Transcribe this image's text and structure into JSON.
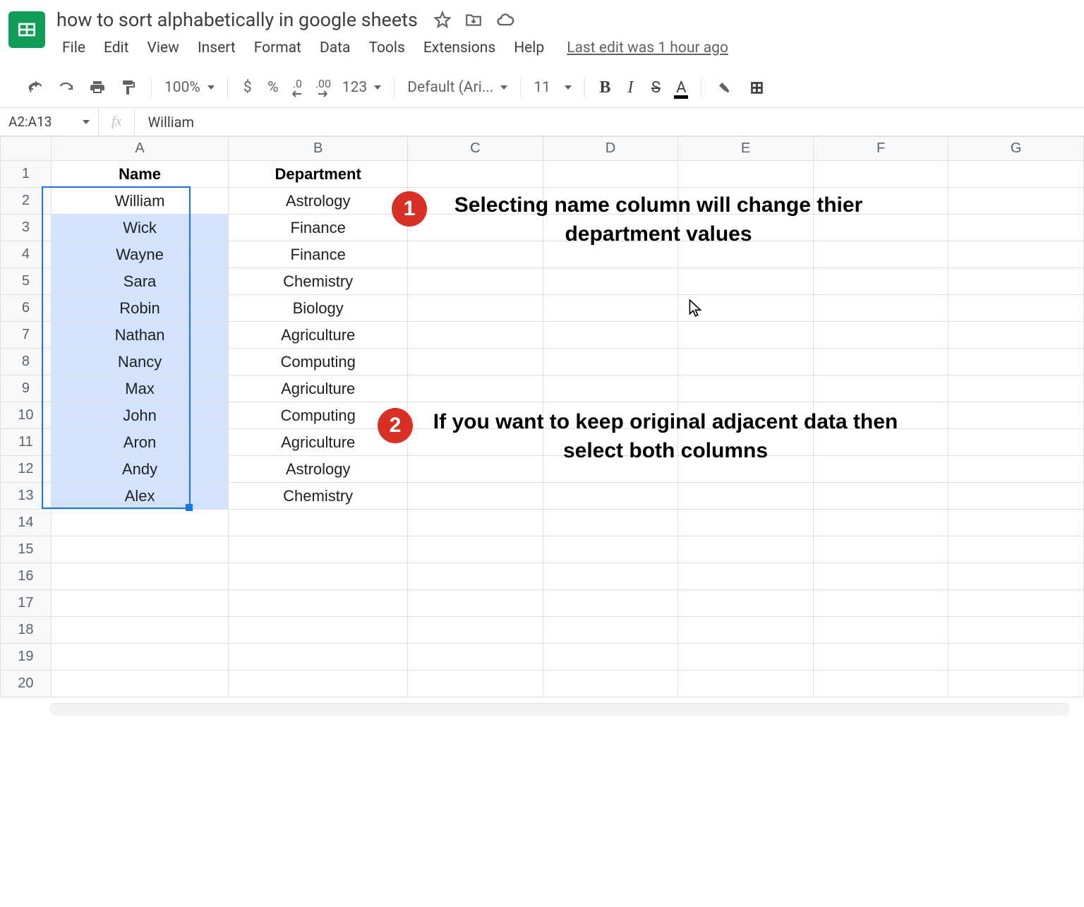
{
  "doc": {
    "title": "how to sort alphabetically in google sheets",
    "last_edit": "Last edit was 1 hour ago"
  },
  "menu": {
    "file": "File",
    "edit": "Edit",
    "view": "View",
    "insert": "Insert",
    "format": "Format",
    "data": "Data",
    "tools": "Tools",
    "extensions": "Extensions",
    "help": "Help"
  },
  "toolbar": {
    "zoom": "100%",
    "currency": "$",
    "percent": "%",
    "dec_dec": ".0",
    "inc_dec": ".00",
    "numfmt": "123",
    "font": "Default (Ari...",
    "font_size": "11",
    "bold": "B",
    "italic": "I",
    "strike": "S",
    "textcolor": "A"
  },
  "namebox": "A2:A13",
  "fx_label": "fx",
  "fx_value": "William",
  "columns": [
    "A",
    "B",
    "C",
    "D",
    "E",
    "F",
    "G"
  ],
  "headers": {
    "name": "Name",
    "department": "Department"
  },
  "rows": [
    {
      "name": "William",
      "dept": "Astrology"
    },
    {
      "name": "Wick",
      "dept": "Finance"
    },
    {
      "name": "Wayne",
      "dept": "Finance"
    },
    {
      "name": "Sara",
      "dept": "Chemistry"
    },
    {
      "name": "Robin",
      "dept": "Biology"
    },
    {
      "name": "Nathan",
      "dept": "Agriculture"
    },
    {
      "name": "Nancy",
      "dept": "Computing"
    },
    {
      "name": "Max",
      "dept": "Agriculture"
    },
    {
      "name": "John",
      "dept": "Computing"
    },
    {
      "name": "Aron",
      "dept": "Agriculture"
    },
    {
      "name": "Andy",
      "dept": "Astrology"
    },
    {
      "name": "Alex",
      "dept": "Chemistry"
    }
  ],
  "row_count": 20,
  "annotations": {
    "a1_num": "1",
    "a1_text": "Selecting name column will change thier department values",
    "a2_num": "2",
    "a2_text": "If you want to keep original adjacent data then select both columns"
  }
}
